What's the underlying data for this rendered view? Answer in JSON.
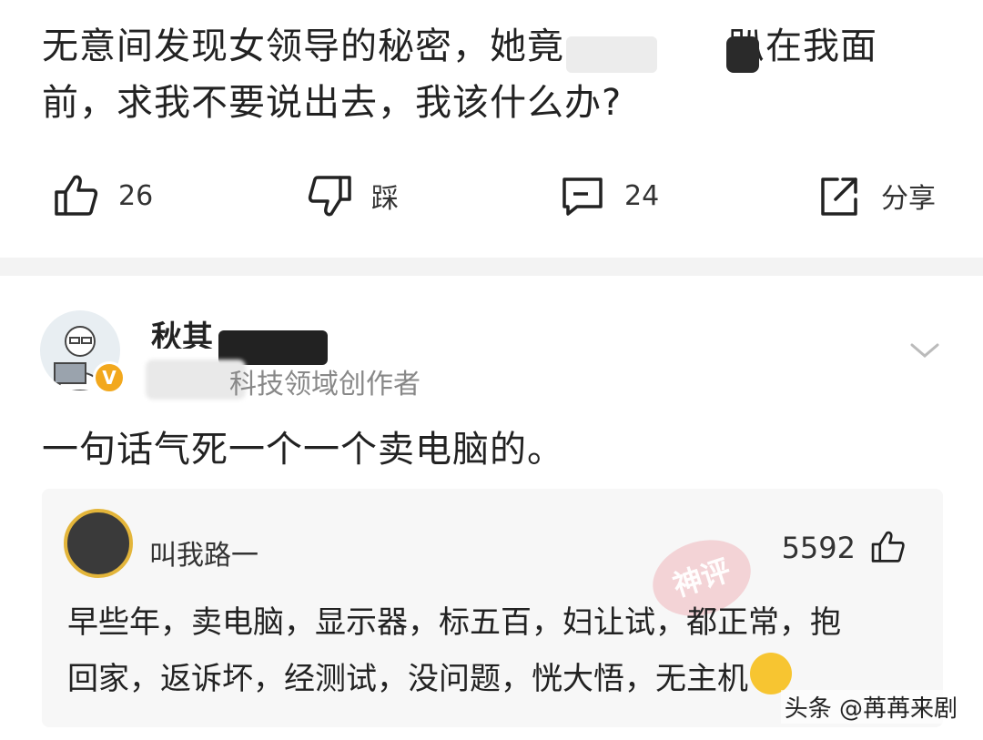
{
  "question": {
    "line1_prefix": "无意间发现女领导的秘密，她竟",
    "line1_suffix": "趴在我面",
    "line2": "前，求我不要说出去，我该什么办?"
  },
  "actions": {
    "like_count": "26",
    "dislike_label": "踩",
    "comment_count": "24",
    "share_label": "分享"
  },
  "comment": {
    "username": "秋其",
    "user_title": "科技领域创作者",
    "verified_badge": "V",
    "text": "一句话气死一个一个卖电脑的。",
    "reply": {
      "name": "叫我路一",
      "likes": "5592",
      "stamp": "神评",
      "line1": "早些年，卖电脑，显示器，标五百，妇让试，都正常，抱",
      "line2": "回家，返诉坏，经测试，没问题，恍大悟，无主机"
    }
  },
  "watermark": "头条 @苒苒来剧",
  "colors": {
    "badge": "#f2a81d",
    "stamp": "#e97882",
    "divider": "#f3f3f3",
    "reply_bg": "#f7f7f7"
  }
}
